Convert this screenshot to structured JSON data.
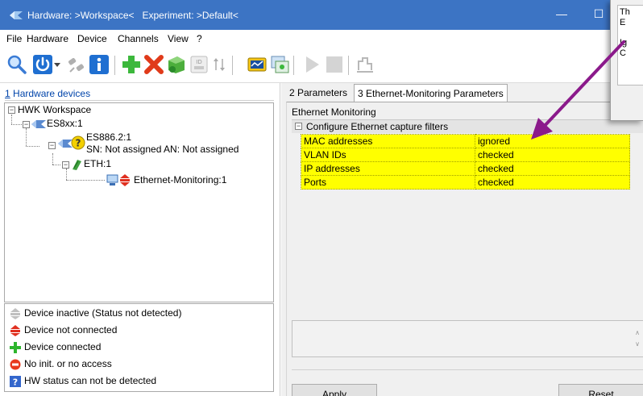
{
  "window": {
    "title": "Hardware: >Workspace<   Experiment: >Default<",
    "minimize": "—",
    "maximize": "☐"
  },
  "menu": [
    "File",
    "Hardware",
    "Device",
    "Channels",
    "View",
    "?"
  ],
  "toolbar": {
    "icons": [
      "search-icon",
      "power-icon",
      "dropdown-arrow-icon",
      "disconnect-icon",
      "info-icon",
      "add-icon",
      "delete-icon",
      "device-add-icon",
      "id-card-icon",
      "sort-icon",
      "measure-icon",
      "workspace-icon",
      "play-icon",
      "stop-icon",
      "signal-icon"
    ]
  },
  "left": {
    "header": "Hardware devices",
    "header_accel": "1",
    "tree": {
      "root": "HWK Workspace",
      "es8xx": "ES8xx:1",
      "es886": "ES886.2:1",
      "es886_sub": "SN: Not assigned AN: Not assigned",
      "eth": "ETH:1",
      "ethmon": "Ethernet-Monitoring:1"
    },
    "legend": [
      {
        "icon": "device-inactive-icon",
        "label": "Device inactive (Status not detected)",
        "color": "#c0c0c0"
      },
      {
        "icon": "device-not-connected-icon",
        "label": "Device not connected",
        "color": "#e03020"
      },
      {
        "icon": "device-connected-icon",
        "label": "Device connected",
        "color": "#2db52d"
      },
      {
        "icon": "no-access-icon",
        "label": "No init. or no access",
        "color": "#e83a1e"
      },
      {
        "icon": "hw-status-unknown-icon",
        "label": "HW status can not be detected",
        "color": "#3366cc"
      }
    ]
  },
  "right": {
    "tabs": [
      "2 Parameters",
      "3 Ethernet-Monitoring Parameters"
    ],
    "section": "Ethernet Monitoring",
    "group": "Configure Ethernet capture filters",
    "rows": [
      {
        "key": "MAC addresses",
        "value": "ignored"
      },
      {
        "key": "VLAN IDs",
        "value": "checked"
      },
      {
        "key": "IP addresses",
        "value": "checked"
      },
      {
        "key": "Ports",
        "value": "checked"
      }
    ],
    "apply": "Apply",
    "reset": "Reset"
  },
  "dialog": {
    "lines": [
      "Th",
      "E",
      "Ig",
      "C"
    ]
  },
  "colors": {
    "titlebar": "#3c74c4",
    "highlight": "#ffff00",
    "arrow": "#8b1a8b"
  }
}
